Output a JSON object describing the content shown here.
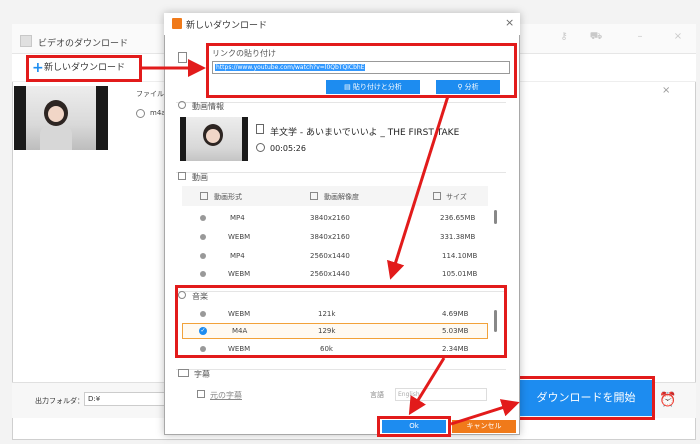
{
  "main": {
    "title": "ビデオのダウンロード",
    "new_download_label": "新しいダウンロード",
    "plus_glyph": "+",
    "file_name_label": "ファイル名",
    "format_label": "m4a",
    "close_glyph": "×",
    "output_folder_label": "出力フォルダ：",
    "output_folder_value": "D:¥",
    "start_download_label": "ダウンロードを開始"
  },
  "dialog": {
    "title": "新しいダウンロード",
    "close_glyph": "×",
    "paste_link_section": "リンクの貼り付け",
    "url_value": "https://www.youtube.com/watch?v=l0QbTQiCbhE",
    "paste_and_analyze_label": "貼り付けと分析",
    "analyze_label": "分析",
    "video_info_section": "動画情報",
    "video_title": "羊文学 - あいまいでいいよ _ THE FIRST TAKE",
    "duration": "00:05:26",
    "video_section": "動画",
    "audio_section": "音楽",
    "subtitle_section": "字幕",
    "original_subtitle_label": "元の字幕",
    "language_label": "言語",
    "language_value": "English",
    "ok_label": "Ok",
    "cancel_label": "キャンセル"
  },
  "video_table": {
    "headers": [
      "動画形式",
      "動画解像度",
      "サイズ"
    ],
    "rows": [
      {
        "format": "MP4",
        "resolution": "3840x2160",
        "size": "236.65MB"
      },
      {
        "format": "WEBM",
        "resolution": "3840x2160",
        "size": "331.38MB"
      },
      {
        "format": "MP4",
        "resolution": "2560x1440",
        "size": "114.10MB"
      },
      {
        "format": "WEBM",
        "resolution": "2560x1440",
        "size": "105.01MB"
      }
    ]
  },
  "audio_table": {
    "rows": [
      {
        "format": "WEBM",
        "bitrate": "121k",
        "size": "4.69MB",
        "selected": false
      },
      {
        "format": "M4A",
        "bitrate": "129k",
        "size": "5.03MB",
        "selected": true
      },
      {
        "format": "WEBM",
        "bitrate": "60k",
        "size": "2.34MB",
        "selected": false
      }
    ]
  },
  "colors": {
    "accent": "#1d8cf0",
    "annotation_red": "#e21b1b",
    "cancel_orange": "#f07a1a",
    "selected_border": "#f2a23a"
  }
}
